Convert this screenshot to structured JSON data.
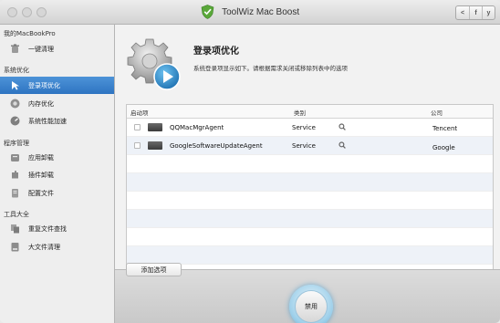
{
  "window": {
    "title": "ToolWiz Mac Boost"
  },
  "share": [
    {
      "label": "<"
    },
    {
      "label": "f"
    },
    {
      "label": "y"
    }
  ],
  "sidebar": {
    "device": "我的MacBookPro",
    "top_item": {
      "label": "一键清理",
      "icon": "trash-icon"
    },
    "sections": [
      {
        "title": "系统优化",
        "items": [
          {
            "label": "登录项优化",
            "icon": "startup-icon",
            "active": true
          },
          {
            "label": "内存优化",
            "icon": "memory-icon"
          },
          {
            "label": "系统性能加速",
            "icon": "speed-icon"
          }
        ]
      },
      {
        "title": "程序管理",
        "items": [
          {
            "label": "应用卸载",
            "icon": "uninstall-icon"
          },
          {
            "label": "插件卸载",
            "icon": "plugin-icon"
          },
          {
            "label": "配置文件",
            "icon": "config-icon"
          }
        ]
      },
      {
        "title": "工具大全",
        "items": [
          {
            "label": "重复文件查找",
            "icon": "duplicate-icon"
          },
          {
            "label": "大文件清理",
            "icon": "bigfile-icon"
          }
        ]
      }
    ]
  },
  "main": {
    "title": "登录项优化",
    "description": "系统登录项显示如下。请根据需求关闭或移除列表中的选项",
    "table": {
      "headers": {
        "startup": "启动项",
        "type": "类别",
        "company": "公司"
      },
      "rows": [
        {
          "name": "QQMacMgrAgent",
          "type": "Service",
          "company": "Tencent"
        },
        {
          "name": "GoogleSoftwareUpdateAgent",
          "type": "Service",
          "company": "Google"
        }
      ]
    },
    "add_button": "添加选项",
    "disable_button": "禁用"
  },
  "colors": {
    "accent": "#2e74c1",
    "ring": "#5ea9d2"
  }
}
